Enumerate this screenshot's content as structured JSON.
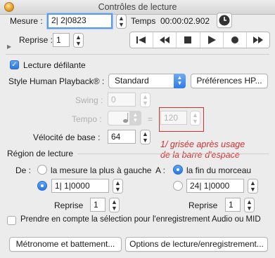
{
  "window": {
    "title": "Contrôles de lecture"
  },
  "top": {
    "mesure_label": "Mesure :",
    "mesure_value": "2| 2|0823",
    "temps_label": "Temps",
    "temps_value": "00:00:02.902",
    "reprise_label": "Reprise :",
    "reprise_value": "1"
  },
  "transport": {
    "buttons": [
      "go-to-start",
      "rewind",
      "stop",
      "play",
      "record",
      "fast-forward"
    ]
  },
  "options": {
    "lecture_defilante_label": "Lecture défilante",
    "lecture_defilante_checked": true,
    "human_playback_label": "Style Human Playback® :",
    "human_playback_value": "Standard",
    "preferences_hp_label": "Préférences HP...",
    "swing_label": "Swing :",
    "swing_value": "0",
    "tempo_label": "Tempo :",
    "tempo_value": "120",
    "tempo_equals": "=",
    "velocite_label": "Vélocité de base :",
    "velocite_value": "64"
  },
  "annotation": {
    "text_line1": "1/ grisée après usage",
    "text_line2": "de la barre d'espace",
    "color": "#d32f2f"
  },
  "region": {
    "title": "Région de lecture",
    "de_label": "De :",
    "a_label": "A :",
    "from_left_label": "la mesure la plus à gauche",
    "from_left_selected": false,
    "from_value": "1| 1|0000",
    "from_value_selected": true,
    "to_end_label": "la fin du morceau",
    "to_end_selected": true,
    "to_value": "24| 1|0000",
    "to_value_selected": false,
    "reprise_label": "Reprise",
    "reprise_from": "1",
    "reprise_to": "1"
  },
  "bottom": {
    "selection_label": "Prendre en compte la sélection pour l'enregistrement Audio ou MID",
    "selection_checked": false,
    "metronome_button": "Métronome et battement...",
    "options_button": "Options de lecture/enregistrement..."
  },
  "colors": {
    "accent": "#2e7be6",
    "annotation": "#d32f2f"
  }
}
